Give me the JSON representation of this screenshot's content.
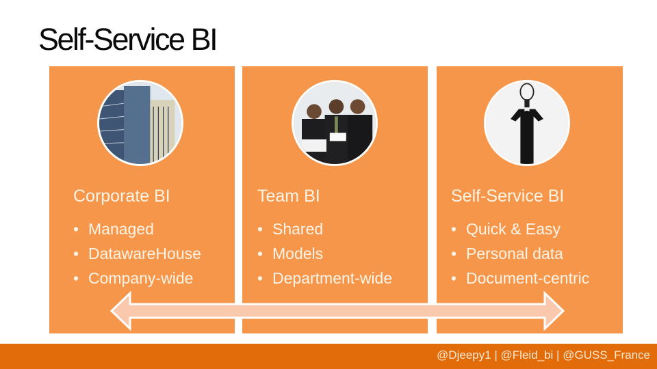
{
  "slide": {
    "title": "Self-Service BI",
    "colors": {
      "panel": "#f5964b",
      "footer": "#e36c0a",
      "arrow_fill": "#fac8ad",
      "text_light": "#fff4e6"
    }
  },
  "panels": [
    {
      "image": "office-building-photo",
      "heading": "Corporate BI",
      "bullets": [
        "Managed",
        "DatawareHouse",
        "Company-wide"
      ]
    },
    {
      "image": "business-team-meeting-photo",
      "heading": "Team BI",
      "bullets": [
        "Shared",
        "Models",
        "Department-wide"
      ]
    },
    {
      "image": "person-holding-lightbulb-photo",
      "heading": "Self-Service BI",
      "bullets": [
        "Quick & Easy",
        "Personal data",
        "Document-centric"
      ]
    }
  ],
  "bullet_glyph": "•",
  "arrow": {
    "type": "double-headed-arrow"
  },
  "footer": {
    "text": "@Djeepy1 | @Fleid_bi | @GUSS_France"
  }
}
